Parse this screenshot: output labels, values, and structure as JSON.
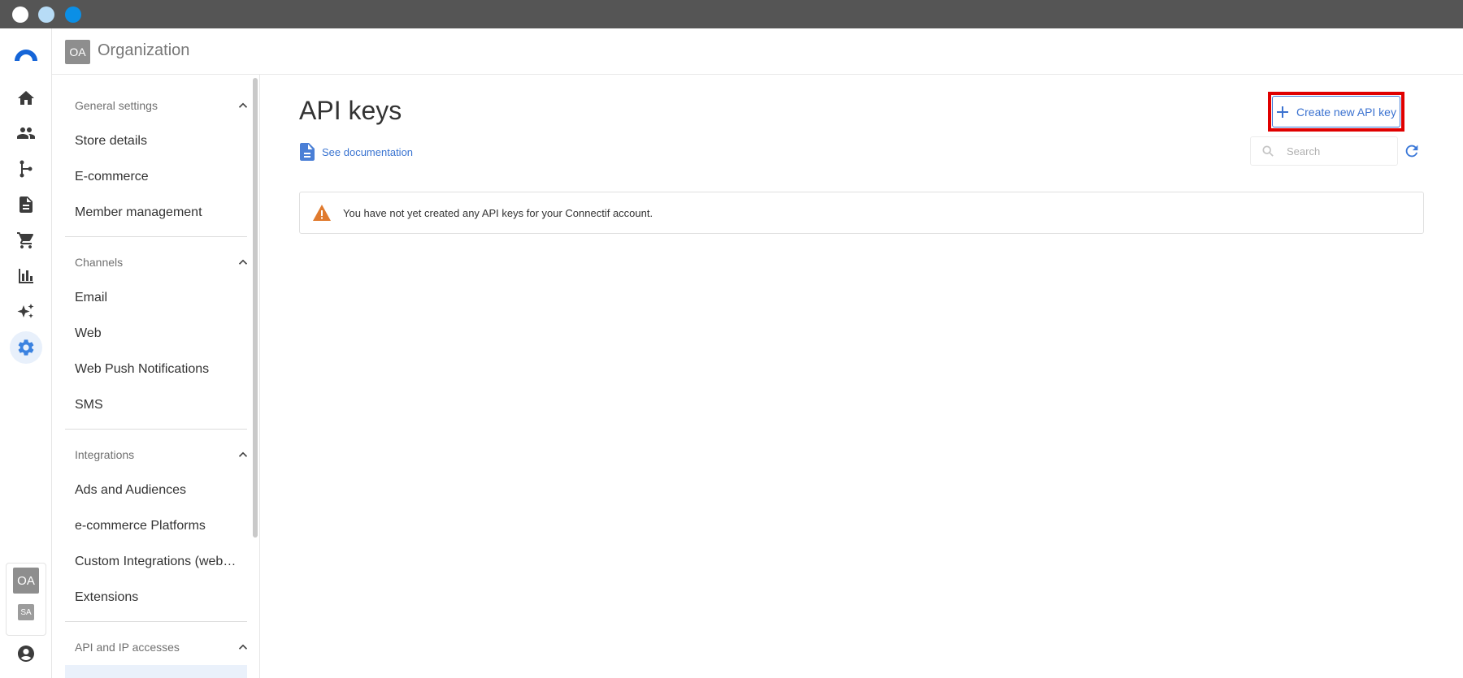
{
  "window": {
    "controls": [
      "close",
      "minimize",
      "maximize"
    ]
  },
  "rail": {
    "logo_icon": "connectif-logo-icon",
    "nav_items": [
      {
        "name": "home",
        "icon": "home-icon"
      },
      {
        "name": "contacts",
        "icon": "people-icon"
      },
      {
        "name": "workflows",
        "icon": "branch-icon"
      },
      {
        "name": "content",
        "icon": "document-icon"
      },
      {
        "name": "ecommerce",
        "icon": "cart-icon"
      },
      {
        "name": "reports",
        "icon": "bar-chart-icon"
      },
      {
        "name": "ai",
        "icon": "sparkles-icon"
      },
      {
        "name": "settings",
        "icon": "gear-icon",
        "active": true
      }
    ],
    "account_primary": "OA",
    "account_secondary": "SA",
    "user_icon": "user-account-icon"
  },
  "topbar": {
    "org_badge": "OA",
    "org_name": "Organization"
  },
  "settings": {
    "sections": [
      {
        "title": "General settings",
        "items": [
          "Store details",
          "E-commerce",
          "Member management"
        ]
      },
      {
        "title": "Channels",
        "items": [
          "Email",
          "Web",
          "Web Push Notifications",
          "SMS"
        ]
      },
      {
        "title": "Integrations",
        "items": [
          "Ads and Audiences",
          "e-commerce Platforms",
          "Custom Integrations (webhooks)",
          "Extensions"
        ]
      },
      {
        "title": "API and IP accesses",
        "items": []
      }
    ]
  },
  "main": {
    "title": "API keys",
    "doc_link": "See documentation",
    "create_button": "Create new API key",
    "search_placeholder": "Search",
    "alert_text": "You have not yet created any API keys for your Connectif account.",
    "colors": {
      "accent": "#3b78d8",
      "warning": "#e07a2e",
      "highlight": "#e00000"
    }
  }
}
